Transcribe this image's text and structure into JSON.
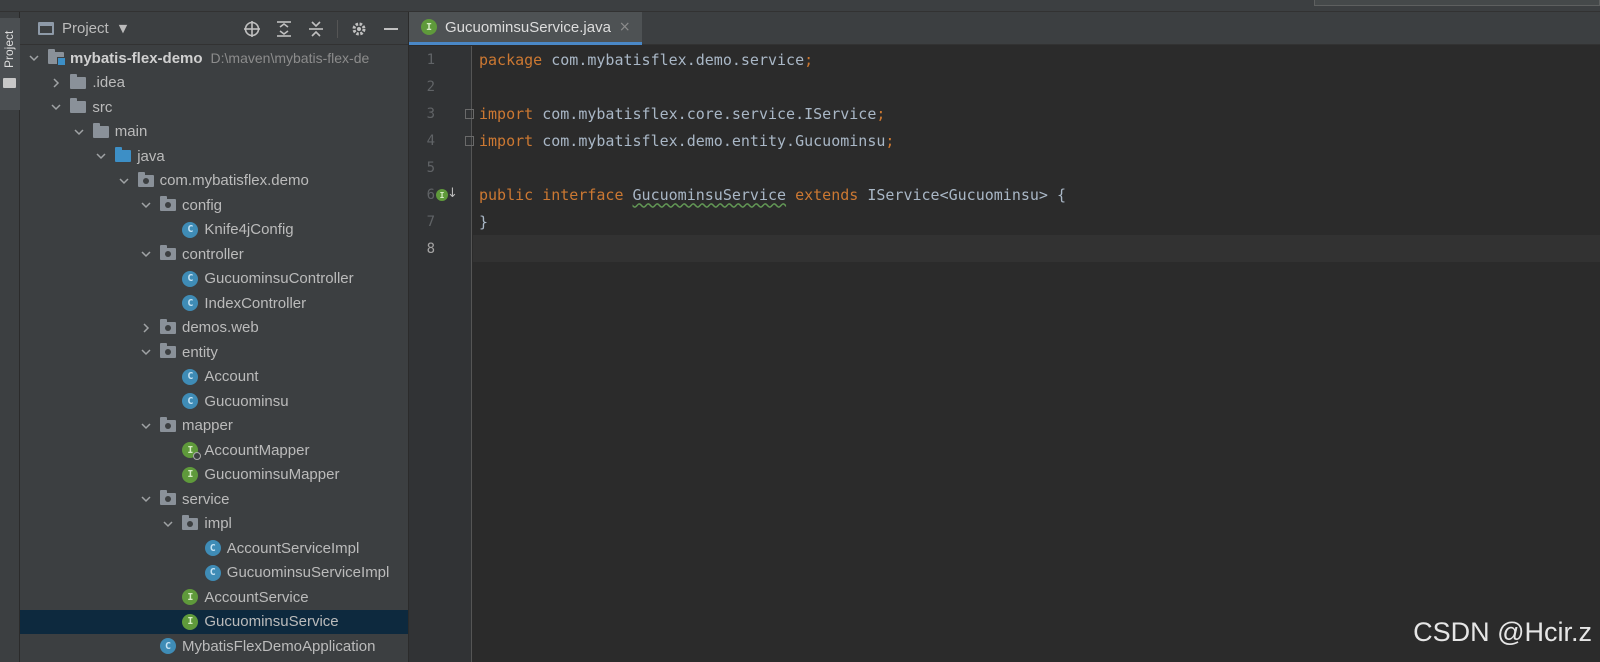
{
  "project_panel": {
    "title": "Project",
    "vertical_tab_label": "Project"
  },
  "tree": [
    {
      "depth": 0,
      "arrow": "down",
      "icon": "folder-module",
      "label": "mybatis-flex-demo",
      "bold": true,
      "hint": "D:\\maven\\mybatis-flex-de"
    },
    {
      "depth": 1,
      "arrow": "right",
      "icon": "folder",
      "label": ".idea"
    },
    {
      "depth": 1,
      "arrow": "down",
      "icon": "folder",
      "label": "src"
    },
    {
      "depth": 2,
      "arrow": "down",
      "icon": "folder",
      "label": "main"
    },
    {
      "depth": 3,
      "arrow": "down",
      "icon": "folder-blue",
      "label": "java"
    },
    {
      "depth": 4,
      "arrow": "down",
      "icon": "package",
      "label": "com.mybatisflex.demo"
    },
    {
      "depth": 5,
      "arrow": "down",
      "icon": "package",
      "label": "config"
    },
    {
      "depth": 6,
      "arrow": "none",
      "icon": "class",
      "label": "Knife4jConfig"
    },
    {
      "depth": 5,
      "arrow": "down",
      "icon": "package",
      "label": "controller"
    },
    {
      "depth": 6,
      "arrow": "none",
      "icon": "class",
      "label": "GucuominsuController"
    },
    {
      "depth": 6,
      "arrow": "none",
      "icon": "class",
      "label": "IndexController"
    },
    {
      "depth": 5,
      "arrow": "right",
      "icon": "package",
      "label": "demos.web"
    },
    {
      "depth": 5,
      "arrow": "down",
      "icon": "package",
      "label": "entity"
    },
    {
      "depth": 6,
      "arrow": "none",
      "icon": "class",
      "label": "Account"
    },
    {
      "depth": 6,
      "arrow": "none",
      "icon": "class",
      "label": "Gucuominsu"
    },
    {
      "depth": 5,
      "arrow": "down",
      "icon": "package",
      "label": "mapper"
    },
    {
      "depth": 6,
      "arrow": "none",
      "icon": "interface-badge",
      "label": "AccountMapper"
    },
    {
      "depth": 6,
      "arrow": "none",
      "icon": "interface",
      "label": "GucuominsuMapper"
    },
    {
      "depth": 5,
      "arrow": "down",
      "icon": "package",
      "label": "service"
    },
    {
      "depth": 6,
      "arrow": "down",
      "icon": "package",
      "label": "impl"
    },
    {
      "depth": 7,
      "arrow": "none",
      "icon": "class",
      "label": "AccountServiceImpl"
    },
    {
      "depth": 7,
      "arrow": "none",
      "icon": "class",
      "label": "GucuominsuServiceImpl"
    },
    {
      "depth": 6,
      "arrow": "none",
      "icon": "interface",
      "label": "AccountService"
    },
    {
      "depth": 6,
      "arrow": "none",
      "icon": "interface",
      "label": "GucuominsuService",
      "selected": true
    },
    {
      "depth": 5,
      "arrow": "none",
      "icon": "app",
      "label": "MybatisFlexDemoApplication"
    }
  ],
  "editor": {
    "tab": {
      "label": "GucuominsuService.java",
      "icon_letter": "I",
      "close": "×"
    },
    "lines": [
      {
        "n": "1"
      },
      {
        "n": "2"
      },
      {
        "n": "3"
      },
      {
        "n": "4"
      },
      {
        "n": "5"
      },
      {
        "n": "6"
      },
      {
        "n": "7"
      },
      {
        "n": "8"
      }
    ],
    "code": {
      "l1_kw": "package",
      "l1_rest": " com.mybatisflex.demo.service",
      "l3_kw": "import",
      "l3_rest": " com.mybatisflex.core.service.IService",
      "l4_kw": "import",
      "l4_rest": " com.mybatisflex.demo.entity.Gucuominsu",
      "semi": ";",
      "l6_kw1": "public",
      "l6_kw2": "interface",
      "l6_name": "GucuominsuService",
      "l6_kw3": "extends",
      "l6_rest": " IService<Gucuominsu> {",
      "l7": "}"
    }
  },
  "watermark": "CSDN @Hcir.z",
  "colors": {
    "keyword": "#cc7832",
    "text": "#a9b7c6",
    "background": "#2b2b2b",
    "panel": "#3c3f41",
    "selection": "#0d293e",
    "tab_underline": "#4a88c7"
  }
}
